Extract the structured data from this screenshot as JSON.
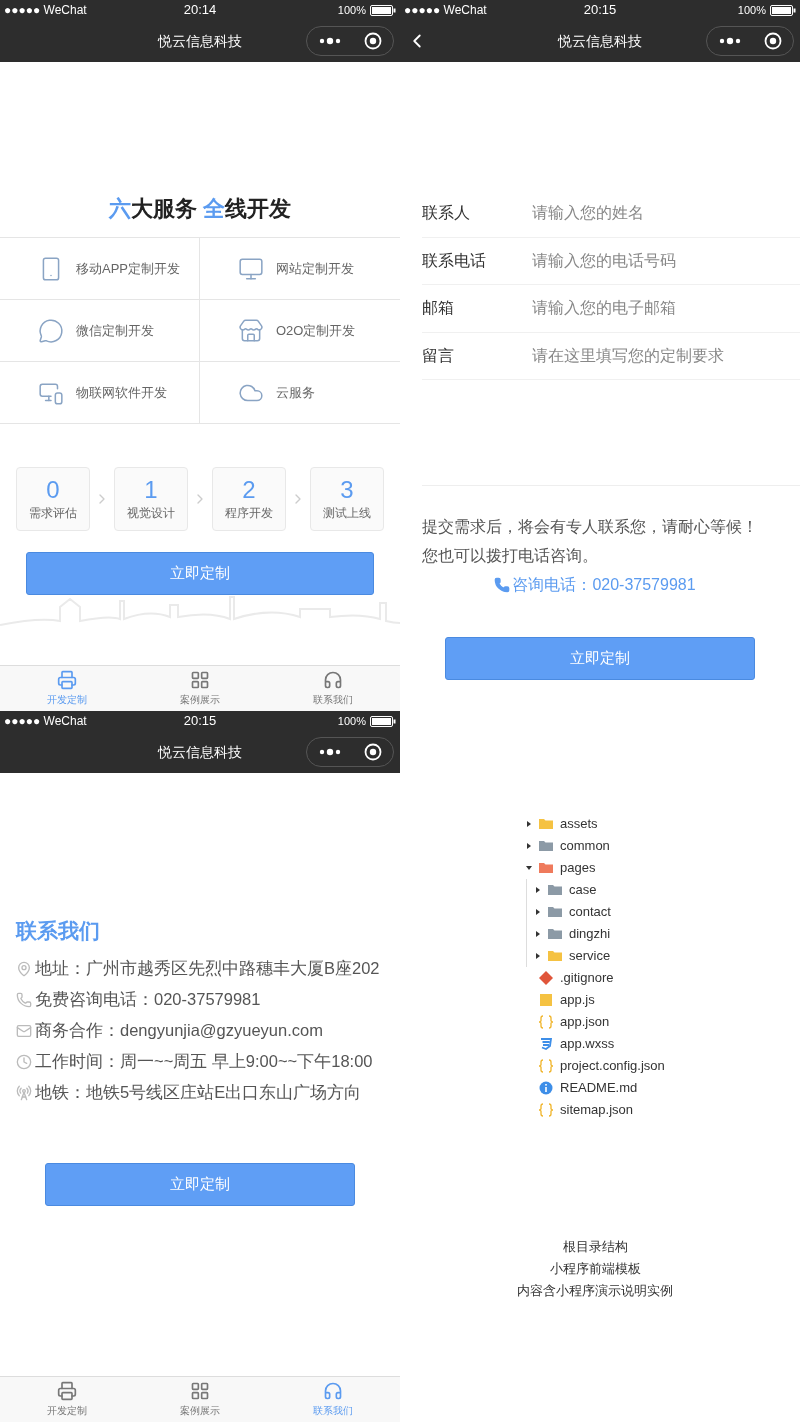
{
  "services_screen": {
    "status": {
      "carrier": "●●●●● WeChat",
      "time": "20:14",
      "battery": "100%"
    },
    "nav": {
      "title": "悦云信息科技",
      "back": false
    },
    "heading": [
      {
        "text": "六",
        "accent": true
      },
      {
        "text": "大服务 ",
        "accent": false
      },
      {
        "text": "全",
        "accent": true
      },
      {
        "text": "线开发",
        "accent": false
      }
    ],
    "services": [
      {
        "kind": "phone",
        "label": "移动APP定制开发"
      },
      {
        "kind": "monitor",
        "label": "网站定制开发"
      },
      {
        "kind": "chat",
        "label": "微信定制开发"
      },
      {
        "kind": "store",
        "label": "O2O定制开发"
      },
      {
        "kind": "devices",
        "label": "物联网软件开发"
      },
      {
        "kind": "cloud",
        "label": "云服务"
      }
    ],
    "steps": [
      {
        "number": "0",
        "label": "需求评估"
      },
      {
        "number": "1",
        "label": "视觉设计"
      },
      {
        "number": "2",
        "label": "程序开发"
      },
      {
        "number": "3",
        "label": "测试上线"
      }
    ],
    "button": "立即定制",
    "tabbar": [
      {
        "kind": "printer",
        "label": "开发定制",
        "selected": true
      },
      {
        "kind": "grid",
        "label": "案例展示",
        "selected": false
      },
      {
        "kind": "headset",
        "label": "联系我们",
        "selected": false
      }
    ]
  },
  "form_screen": {
    "status": {
      "carrier": "●●●●● WeChat",
      "time": "20:15",
      "battery": "100%"
    },
    "nav": {
      "title": "悦云信息科技",
      "back": true
    },
    "fields": [
      {
        "label": "联系人",
        "placeholder": "请输入您的姓名"
      },
      {
        "label": "联系电话",
        "placeholder": "请输入您的电话号码"
      },
      {
        "label": "邮箱",
        "placeholder": "请输入您的电子邮箱"
      },
      {
        "label": "留言",
        "placeholder": "请在这里填写您的定制要求"
      }
    ],
    "notice": [
      "提交需求后，将会有专人联系您，请耐心等候！",
      "您也可以拨打电话咨询。"
    ],
    "hotline": "咨询电话：020-37579981",
    "button": "立即定制"
  },
  "contact_screen": {
    "status": {
      "carrier": "●●●●● WeChat",
      "time": "20:15",
      "battery": "100%"
    },
    "nav": {
      "title": "悦云信息科技",
      "back": false
    },
    "title": "联系我们",
    "lines": [
      {
        "kind": "pin",
        "text": "地址：广州市越秀区先烈中路穗丰大厦B座202"
      },
      {
        "kind": "phone",
        "text": "免费咨询电话：020-37579981"
      },
      {
        "kind": "mail",
        "text": "商务合作：dengyunjia@gzyueyun.com"
      },
      {
        "kind": "clock",
        "text": "工作时间：周一~~周五 早上9:00~~下午18:00"
      },
      {
        "kind": "metro",
        "text": "地铁：地铁5号线区庄站E出口东山广场方向"
      }
    ],
    "button": "立即定制",
    "tabbar": [
      {
        "kind": "printer",
        "label": "开发定制",
        "selected": false
      },
      {
        "kind": "grid",
        "label": "案例展示",
        "selected": false
      },
      {
        "kind": "headset",
        "label": "联系我们",
        "selected": true
      }
    ]
  },
  "file_tree": [
    {
      "kind": "folder",
      "name": "assets",
      "color": "#f5c242",
      "expanded": false
    },
    {
      "kind": "folder",
      "name": "common",
      "color": "#8c9aa6",
      "expanded": false
    },
    {
      "kind": "folder",
      "name": "pages",
      "color": "#ef7a5c",
      "expanded": true,
      "children": [
        {
          "kind": "folder",
          "name": "case",
          "color": "#8c9aa6",
          "expanded": false
        },
        {
          "kind": "folder",
          "name": "contact",
          "color": "#8c9aa6",
          "expanded": false
        },
        {
          "kind": "folder",
          "name": "dingzhi",
          "color": "#8c9aa6",
          "expanded": false
        },
        {
          "kind": "folder",
          "name": "service",
          "color": "#f5c242",
          "expanded": false
        }
      ]
    },
    {
      "kind": "git",
      "name": ".gitignore"
    },
    {
      "kind": "js",
      "name": "app.js"
    },
    {
      "kind": "json",
      "name": "app.json"
    },
    {
      "kind": "css",
      "name": "app.wxss"
    },
    {
      "kind": "json",
      "name": "project.config.json"
    },
    {
      "kind": "info",
      "name": "README.md"
    },
    {
      "kind": "json",
      "name": "sitemap.json"
    }
  ],
  "caption": [
    "根目录结构",
    "小程序前端模板",
    "内容含小程序演示说明实例"
  ]
}
